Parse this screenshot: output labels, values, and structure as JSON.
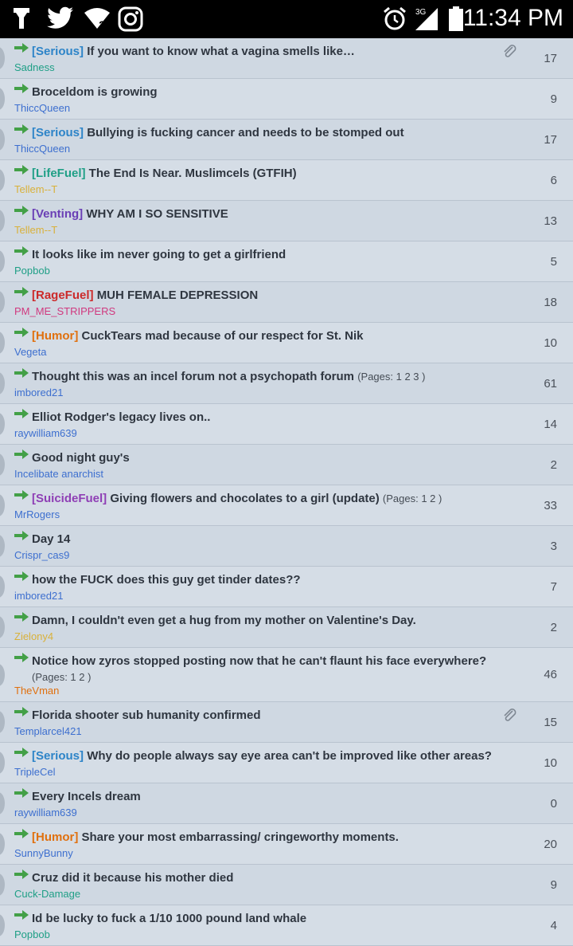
{
  "statusbar": {
    "time": "11:34 PM",
    "network": "3G"
  },
  "threads": [
    {
      "prefix": "[Serious]",
      "prefix_color": "#2d84c8",
      "title": "If you want to know what a vagina smells like…",
      "pages": "",
      "author": "Sadness",
      "author_color": "#1f9f86",
      "count": "17",
      "clip": true
    },
    {
      "prefix": "",
      "prefix_color": "",
      "title": "Broceldom is growing",
      "pages": "",
      "author": "ThiccQueen",
      "author_color": "#3d6fcf",
      "count": "9",
      "clip": false
    },
    {
      "prefix": "[Serious]",
      "prefix_color": "#2d84c8",
      "title": "Bullying is fucking cancer and needs to be stomped out",
      "pages": "",
      "author": "ThiccQueen",
      "author_color": "#3d6fcf",
      "count": "17",
      "clip": false
    },
    {
      "prefix": "[LifeFuel]",
      "prefix_color": "#1f9f86",
      "title": "The End Is Near. Muslimcels (GTFIH)",
      "pages": "",
      "author": "Tellem--T",
      "author_color": "#d9b13a",
      "count": "6",
      "clip": false
    },
    {
      "prefix": "[Venting]",
      "prefix_color": "#6a3fb5",
      "title": "WHY AM I SO SENSITIVE",
      "pages": "",
      "author": "Tellem--T",
      "author_color": "#d9b13a",
      "count": "13",
      "clip": false
    },
    {
      "prefix": "",
      "prefix_color": "",
      "title": "It looks like im never going to get a girlfriend",
      "pages": "",
      "author": "Popbob",
      "author_color": "#1f9f86",
      "count": "5",
      "clip": false
    },
    {
      "prefix": "[RageFuel]",
      "prefix_color": "#cc2a2a",
      "title": "MUH FEMALE DEPRESSION",
      "pages": "",
      "author": "PM_ME_STRIPPERS",
      "author_color": "#d0397f",
      "count": "18",
      "clip": false
    },
    {
      "prefix": "[Humor]",
      "prefix_color": "#e0700e",
      "title": "CuckTears mad because of our respect for St. Nik",
      "pages": "",
      "author": "Vegeta",
      "author_color": "#3d6fcf",
      "count": "10",
      "clip": false
    },
    {
      "prefix": "",
      "prefix_color": "",
      "title": "Thought this was an incel forum not a psychopath forum",
      "pages": "(Pages: 1 2 3 )",
      "author": "imbored21",
      "author_color": "#3d6fcf",
      "count": "61",
      "clip": false
    },
    {
      "prefix": "",
      "prefix_color": "",
      "title": "Elliot Rodger's legacy lives on..",
      "pages": "",
      "author": "raywilliam639",
      "author_color": "#3d6fcf",
      "count": "14",
      "clip": false
    },
    {
      "prefix": "",
      "prefix_color": "",
      "title": "Good night guy's",
      "pages": "",
      "author": "Incelibate anarchist",
      "author_color": "#3d6fcf",
      "count": "2",
      "clip": false
    },
    {
      "prefix": "[SuicideFuel]",
      "prefix_color": "#8f3fb5",
      "title": "Giving flowers and chocolates to a girl (update)",
      "pages": "(Pages: 1 2 )",
      "author": "MrRogers",
      "author_color": "#3d6fcf",
      "count": "33",
      "clip": false
    },
    {
      "prefix": "",
      "prefix_color": "",
      "title": "Day 14",
      "pages": "",
      "author": "Crispr_cas9",
      "author_color": "#3d6fcf",
      "count": "3",
      "clip": false
    },
    {
      "prefix": "",
      "prefix_color": "",
      "title": "how the FUCK does this guy get tinder dates??",
      "pages": "",
      "author": "imbored21",
      "author_color": "#3d6fcf",
      "count": "7",
      "clip": false
    },
    {
      "prefix": "",
      "prefix_color": "",
      "title": "Damn, I couldn't even get a hug from my mother on Valentine's Day.",
      "pages": "",
      "author": "Zielony4",
      "author_color": "#d9b13a",
      "count": "2",
      "clip": false
    },
    {
      "prefix": "",
      "prefix_color": "",
      "title": "Notice how zyros stopped posting now that he can't flaunt his face everywhere?",
      "pages": "(Pages: 1 2 )",
      "author": "TheVman",
      "author_color": "#e0700e",
      "count": "46",
      "clip": false
    },
    {
      "prefix": "",
      "prefix_color": "",
      "title": "Florida shooter sub humanity confirmed",
      "pages": "",
      "author": "Templarcel421",
      "author_color": "#3d6fcf",
      "count": "15",
      "clip": true
    },
    {
      "prefix": "[Serious]",
      "prefix_color": "#2d84c8",
      "title": "Why do people always say eye area can't be improved like other areas?",
      "pages": "",
      "author": "TripleCel",
      "author_color": "#3d6fcf",
      "count": "10",
      "clip": false
    },
    {
      "prefix": "",
      "prefix_color": "",
      "title": "Every Incels dream",
      "pages": "",
      "author": "raywilliam639",
      "author_color": "#3d6fcf",
      "count": "0",
      "clip": false
    },
    {
      "prefix": "[Humor]",
      "prefix_color": "#e0700e",
      "title": "Share your most embarrassing/ cringeworthy moments.",
      "pages": "",
      "author": "SunnyBunny",
      "author_color": "#3d6fcf",
      "count": "20",
      "clip": false
    },
    {
      "prefix": "",
      "prefix_color": "",
      "title": "Cruz did it because his mother died",
      "pages": "",
      "author": "Cuck-Damage",
      "author_color": "#1f9f86",
      "count": "9",
      "clip": false
    },
    {
      "prefix": "",
      "prefix_color": "",
      "title": "Id be lucky to fuck a 1/10 1000 pound land whale",
      "pages": "",
      "author": "Popbob",
      "author_color": "#1f9f86",
      "count": "4",
      "clip": false
    }
  ]
}
